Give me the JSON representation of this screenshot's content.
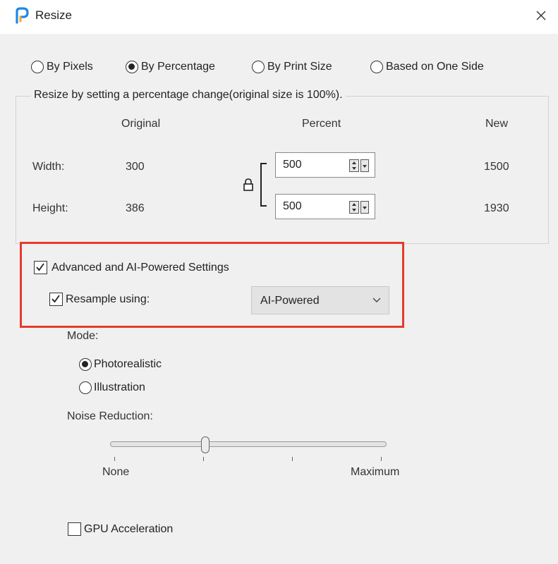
{
  "window": {
    "title": "Resize",
    "icon": "paintshop-app-icon",
    "close_icon": "close-icon"
  },
  "mode_options": [
    {
      "label": "By Pixels",
      "selected": false
    },
    {
      "label": "By Percentage",
      "selected": true
    },
    {
      "label": "By Print Size",
      "selected": false
    },
    {
      "label": "Based on One Side",
      "selected": false
    }
  ],
  "group": {
    "legend": "Resize by setting a percentage change(original size is 100%).",
    "headers": {
      "original": "Original",
      "percent": "Percent",
      "new": "New"
    },
    "width": {
      "label": "Width:",
      "original": "300",
      "percent": "500",
      "new": "1500"
    },
    "height": {
      "label": "Height:",
      "original": "386",
      "percent": "500",
      "new": "1930"
    },
    "lock_icon": "lock-icon"
  },
  "advanced": {
    "label": "Advanced and AI-Powered Settings",
    "checked": true,
    "resample_label": "Resample using:",
    "resample_checked": true,
    "resample_value": "AI-Powered"
  },
  "mode": {
    "label": "Mode:",
    "options": [
      {
        "label": "Photorealistic",
        "selected": true
      },
      {
        "label": "Illustration",
        "selected": false
      }
    ]
  },
  "noise": {
    "label": "Noise Reduction:",
    "min_label": "None",
    "max_label": "Maximum",
    "value_fraction": 0.34
  },
  "gpu": {
    "label": "GPU Acceleration",
    "checked": false
  },
  "colors": {
    "highlight": "#e53b2c",
    "background": "#f0f0f0"
  }
}
